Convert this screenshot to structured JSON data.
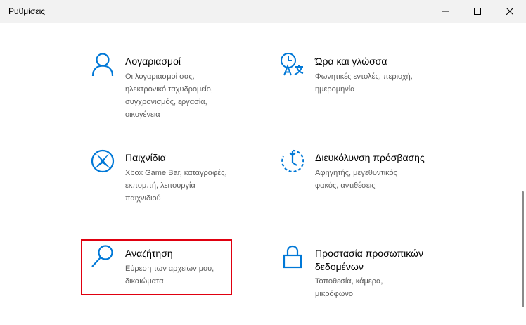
{
  "window": {
    "title": "Ρυθμίσεις",
    "controls": [
      "minimize-icon",
      "maximize-icon",
      "close-icon"
    ]
  },
  "tiles": [
    {
      "icon": "person-icon",
      "name": "Λογαριασμοί",
      "desc": [
        "Οι λογαριασμοί σας,",
        "ηλεκτρονικό ταχυδρομείο,",
        "συγχρονισμός, εργασία,",
        "οικογένεια"
      ]
    },
    {
      "icon": "time-language-icon",
      "name": "Ώρα και γλώσσα",
      "desc": [
        "Φωνητικές εντολές, περιοχή,",
        "ημερομηνία"
      ]
    },
    {
      "icon": "xbox-icon",
      "name": "Παιχνίδια",
      "desc": [
        "Xbox Game Bar, καταγραφές,",
        "εκπομπή, λειτουργία",
        "παιχνιδιού"
      ]
    },
    {
      "icon": "ease-of-access-icon",
      "name": "Διευκόλυνση πρόσβασης",
      "desc": [
        "Αφηγητής, μεγεθυντικός",
        "φακός, αντιθέσεις"
      ]
    },
    {
      "icon": "search-icon",
      "name": "Αναζήτηση",
      "desc": [
        "Εύρεση των αρχείων μου,",
        "δικαιώματα"
      ]
    },
    {
      "icon": "lock-icon",
      "name": "Προστασία προσωπικών δεδομένων",
      "desc": [
        "Τοποθεσία, κάμερα,",
        "μικρόφωνο"
      ]
    }
  ],
  "colors": {
    "accent": "#0078d7",
    "highlight": "#e0000f",
    "titlebar": "#f2f2f2",
    "secondary_text": "#5c5c5c"
  }
}
